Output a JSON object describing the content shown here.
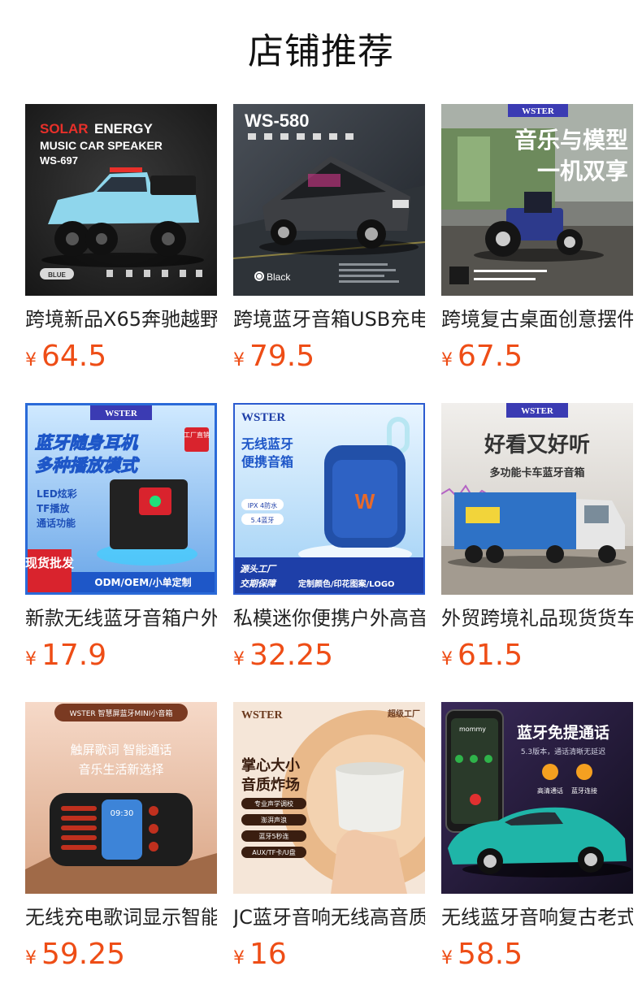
{
  "section_title": "店铺推荐",
  "currency": "¥",
  "products": [
    {
      "name": "跨境新品X65奔驰越野",
      "price": "64.5",
      "image": {
        "icon": "pickup-truck-speaker-image",
        "brand": "SOLAR",
        "line1": "ENERGY",
        "line2": "MUSIC CAR SPEAKER",
        "model": "WS-697",
        "tag": "BLUE"
      }
    },
    {
      "name": "跨境蓝牙音箱USB充电",
      "price": "79.5",
      "image": {
        "icon": "cybertruck-speaker-image",
        "model": "WS-580",
        "color_label": "Black"
      }
    },
    {
      "name": "跨境复古桌面创意摆件",
      "price": "67.5",
      "image": {
        "icon": "tractor-speaker-image",
        "brand": "WSTER",
        "headline1": "音乐与模型",
        "headline2": "一机双享"
      }
    },
    {
      "name": "新款无线蓝牙音箱户外",
      "price": "17.9",
      "image": {
        "icon": "cube-speaker-image",
        "brand": "WSTER",
        "headline1": "蓝牙随身耳机",
        "headline2": "多种播放模式",
        "features": [
          "LED炫彩",
          "TF播放",
          "通话功能"
        ],
        "badge_corner": "工厂直销",
        "badge": "现货批发",
        "banner": "ODM/OEM/小单定制"
      }
    },
    {
      "name": "私模迷你便携户外高音",
      "price": "32.25",
      "image": {
        "icon": "portable-speaker-image",
        "brand": "WSTER",
        "headline1": "无线蓝牙",
        "headline2": "便携音箱",
        "chips": [
          "IPX 4防水",
          "5.4蓝牙"
        ],
        "footer1": "源头工厂",
        "footer2": "交期保障",
        "footer3": "定制颜色/印花图案/LOGO"
      }
    },
    {
      "name": "外贸跨境礼品现货货车",
      "price": "61.5",
      "image": {
        "icon": "truck-speaker-image",
        "brand": "WSTER",
        "headline": "好看又好听",
        "sub": "多功能卡车蓝牙音箱"
      }
    },
    {
      "name": "无线充电歌词显示智能",
      "price": "59.25",
      "image": {
        "icon": "retro-radio-speaker-image",
        "top_label": "WSTER 智慧屏蓝牙MINI小音箱",
        "line1": "触屏歌词  智能通话",
        "line2": "音乐生活新选择",
        "clock": "09:30"
      }
    },
    {
      "name": "JC蓝牙音响无线高音质",
      "price": "16",
      "image": {
        "icon": "mini-cylinder-speaker-image",
        "brand": "WSTER",
        "factory": "超级工厂",
        "headline1": "掌心大小",
        "headline2": "音质炸场",
        "chips": [
          "专业声学调校",
          "澎湃声浪",
          "蓝牙5秒连",
          "AUX/TF卡/U盘"
        ]
      }
    },
    {
      "name": "无线蓝牙音响复古老式",
      "price": "58.5",
      "image": {
        "icon": "classic-car-speaker-image",
        "headline": "蓝牙免提通话",
        "sub": "5.3版本，通话清晰无延迟",
        "caption1": "高清通话",
        "caption2": "蓝牙连接",
        "phone_name": "mommy"
      }
    }
  ]
}
